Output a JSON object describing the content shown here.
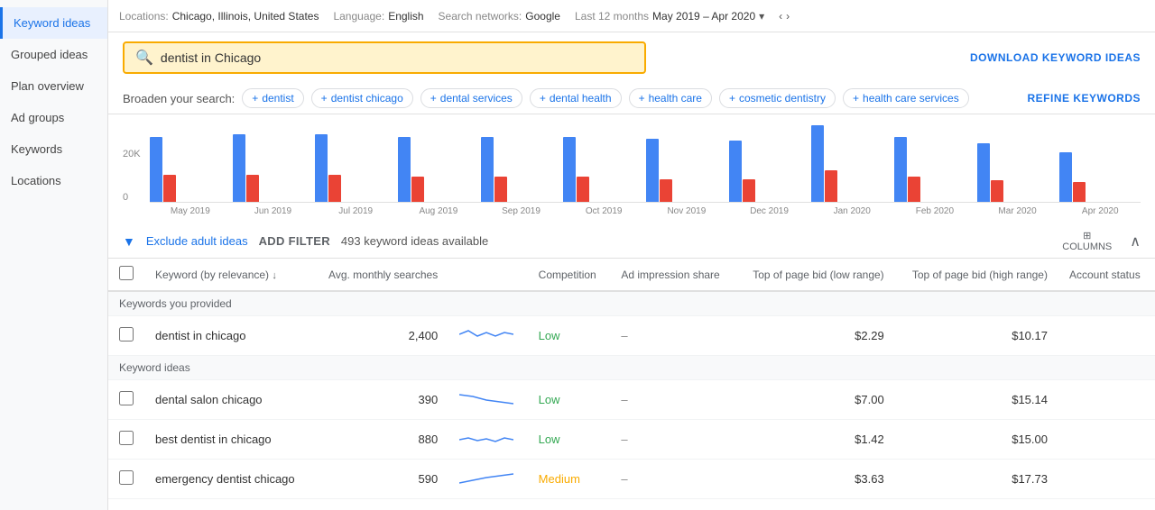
{
  "sidebar": {
    "items": [
      {
        "id": "keyword-ideas",
        "label": "Keyword ideas",
        "active": true
      },
      {
        "id": "grouped-ideas",
        "label": "Grouped ideas",
        "active": false
      },
      {
        "id": "plan-overview",
        "label": "Plan overview",
        "active": false
      },
      {
        "id": "ad-groups",
        "label": "Ad groups",
        "active": false
      },
      {
        "id": "keywords",
        "label": "Keywords",
        "active": false
      },
      {
        "id": "locations",
        "label": "Locations",
        "active": false
      }
    ]
  },
  "topbar": {
    "locations_label": "Locations:",
    "locations_value": "Chicago, Illinois, United States",
    "language_label": "Language:",
    "language_value": "English",
    "networks_label": "Search networks:",
    "networks_value": "Google",
    "date_label": "Last 12 months",
    "date_value": "May 2019 – Apr 2020"
  },
  "search": {
    "value": "dentist in Chicago",
    "placeholder": "dentist in Chicago",
    "download_label": "DOWNLOAD KEYWORD IDEAS"
  },
  "broaden": {
    "label": "Broaden your search:",
    "tags": [
      "dentist",
      "dentist chicago",
      "dental services",
      "dental health",
      "health care",
      "cosmetic dentistry",
      "health care services"
    ],
    "refine_label": "REFINE KEYWORDS"
  },
  "chart": {
    "y_label": "20K",
    "y_zero": "0",
    "months": [
      "May 2019",
      "Jun 2019",
      "Jul 2019",
      "Aug 2019",
      "Sep 2019",
      "Oct 2019",
      "Nov 2019",
      "Dec 2019",
      "Jan 2020",
      "Feb 2020",
      "Mar 2020",
      "Apr 2020"
    ],
    "blue_bars": [
      72,
      75,
      75,
      72,
      72,
      72,
      70,
      68,
      85,
      72,
      65,
      55
    ],
    "red_bars": [
      30,
      30,
      30,
      28,
      28,
      28,
      25,
      25,
      35,
      28,
      24,
      22
    ]
  },
  "filter": {
    "exclude_label": "Exclude adult ideas",
    "add_filter_label": "ADD FILTER",
    "count_text": "493 keyword ideas available",
    "columns_label": "COLUMNS"
  },
  "table": {
    "headers": [
      {
        "id": "keyword",
        "label": "Keyword (by relevance)",
        "sortable": true
      },
      {
        "id": "avg_monthly",
        "label": "Avg. monthly searches"
      },
      {
        "id": "trend",
        "label": ""
      },
      {
        "id": "competition",
        "label": "Competition"
      },
      {
        "id": "impression_share",
        "label": "Ad impression share"
      },
      {
        "id": "bid_low",
        "label": "Top of page bid (low range)"
      },
      {
        "id": "bid_high",
        "label": "Top of page bid (high range)"
      },
      {
        "id": "account_status",
        "label": "Account status"
      }
    ],
    "sections": [
      {
        "section_label": "Keywords you provided",
        "rows": [
          {
            "keyword": "dentist in chicago",
            "avg_monthly": "2,400",
            "competition": "Low",
            "impression_share": "–",
            "bid_low": "$2.29",
            "bid_high": "$10.17",
            "account_status": ""
          }
        ]
      },
      {
        "section_label": "Keyword ideas",
        "rows": [
          {
            "keyword": "dental salon chicago",
            "avg_monthly": "390",
            "competition": "Low",
            "impression_share": "–",
            "bid_low": "$7.00",
            "bid_high": "$15.14",
            "account_status": ""
          },
          {
            "keyword": "best dentist in chicago",
            "avg_monthly": "880",
            "competition": "Low",
            "impression_share": "–",
            "bid_low": "$1.42",
            "bid_high": "$15.00",
            "account_status": ""
          },
          {
            "keyword": "emergency dentist chicago",
            "avg_monthly": "590",
            "competition": "Medium",
            "impression_share": "–",
            "bid_low": "$3.63",
            "bid_high": "$17.73",
            "account_status": ""
          }
        ]
      }
    ]
  }
}
